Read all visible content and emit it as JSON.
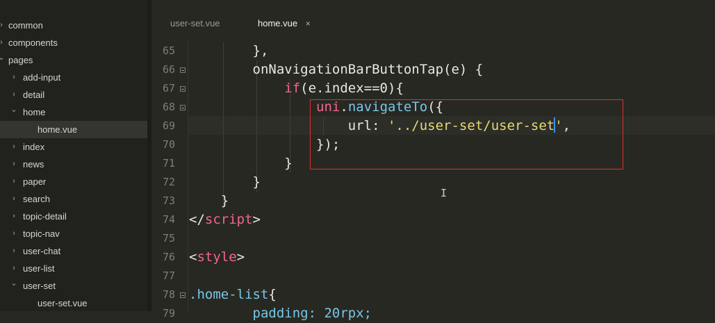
{
  "sidebar": {
    "items": [
      {
        "label": "common",
        "depth": 0,
        "chevron": "right"
      },
      {
        "label": "components",
        "depth": 0,
        "chevron": "right"
      },
      {
        "label": "pages",
        "depth": 0,
        "chevron": "down"
      },
      {
        "label": "add-input",
        "depth": 1,
        "chevron": "right"
      },
      {
        "label": "detail",
        "depth": 1,
        "chevron": "right"
      },
      {
        "label": "home",
        "depth": 1,
        "chevron": "down"
      },
      {
        "label": "home.vue",
        "depth": 2,
        "chevron": "none",
        "active": true
      },
      {
        "label": "index",
        "depth": 1,
        "chevron": "right"
      },
      {
        "label": "news",
        "depth": 1,
        "chevron": "right"
      },
      {
        "label": "paper",
        "depth": 1,
        "chevron": "right"
      },
      {
        "label": "search",
        "depth": 1,
        "chevron": "right"
      },
      {
        "label": "topic-detail",
        "depth": 1,
        "chevron": "right"
      },
      {
        "label": "topic-nav",
        "depth": 1,
        "chevron": "right"
      },
      {
        "label": "user-chat",
        "depth": 1,
        "chevron": "right"
      },
      {
        "label": "user-list",
        "depth": 1,
        "chevron": "right"
      },
      {
        "label": "user-set",
        "depth": 1,
        "chevron": "down"
      },
      {
        "label": "user-set.vue",
        "depth": 2,
        "chevron": "none"
      }
    ]
  },
  "tabs": {
    "tab1": "user-set.vue",
    "tab2": "home.vue",
    "close_glyph": "×"
  },
  "editor": {
    "line_numbers": [
      "65",
      "66",
      "67",
      "68",
      "69",
      "70",
      "71",
      "72",
      "73",
      "74",
      "75",
      "76",
      "77",
      "78",
      "79"
    ],
    "fold_lines": [
      "66",
      "67",
      "68",
      "78"
    ],
    "lines": {
      "l65": "},",
      "l66": "onNavigationBarButtonTap(e) {",
      "l67_kw": "if",
      "l67_rest": "(e.index==0){",
      "l68_obj": "uni",
      "l68_dot": ".",
      "l68_fn": "navigateTo",
      "l68_rest": "({",
      "l69_key": "url: ",
      "l69_str1": "'../user-set/user-set",
      "l69_str2": "'",
      "l69_rest": ",",
      "l70": "});",
      "l71": "}",
      "l72": "}",
      "l73": "}",
      "l74_open": "</",
      "l74_tag": "script",
      "l74_close": ">",
      "l76_open": "<",
      "l76_tag": "style",
      "l76_close": ">",
      "l78_sel": ".home-list",
      "l78_rest": "{",
      "l79_partial": "padding: 20rpx;"
    },
    "ibeam_glyph": "I"
  },
  "colors": {
    "background": "#272822",
    "sidebar": "#21221d",
    "tag": "#f4668b",
    "function": "#78c7e8",
    "string": "#e6db74",
    "highlight_box": "#e0302e",
    "cursor": "#3a8eff"
  }
}
